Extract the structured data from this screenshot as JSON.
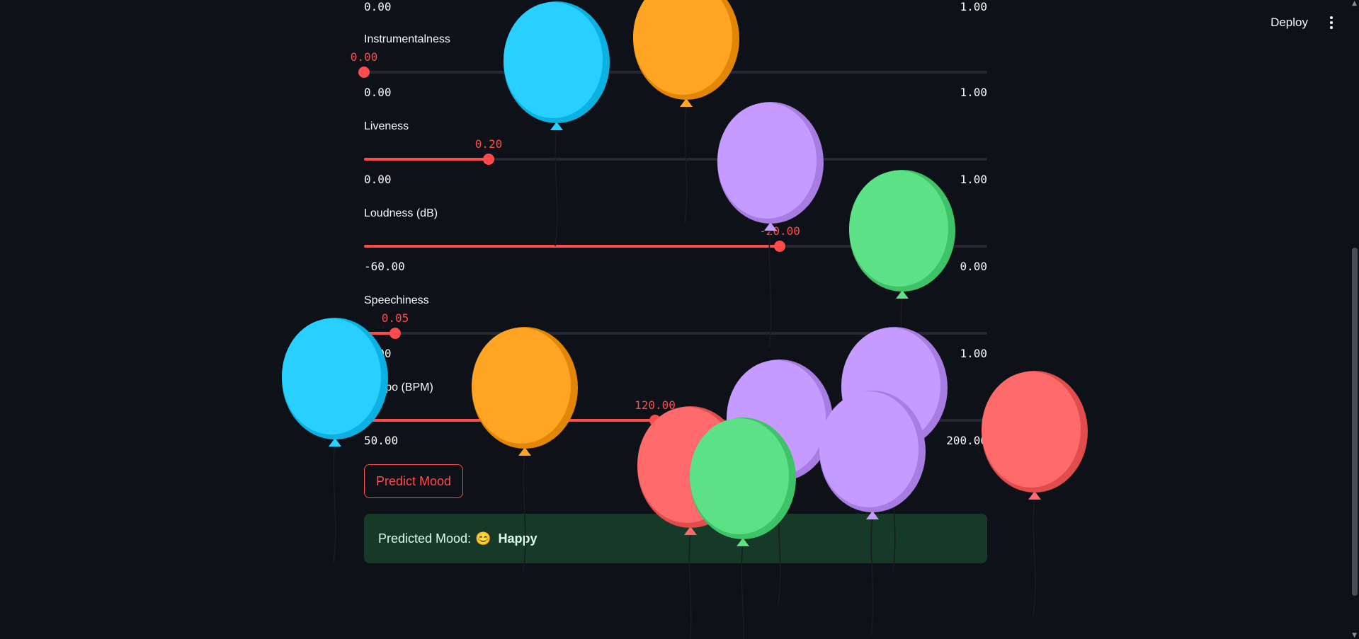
{
  "header": {
    "deploy_label": "Deploy",
    "menu_icon": "kebab-menu-icon"
  },
  "sliders": [
    {
      "label": "",
      "value": "",
      "min": "0.00",
      "max": "1.00",
      "fraction": null
    },
    {
      "label": "Instrumentalness",
      "value": "0.00",
      "min": "0.00",
      "max": "1.00",
      "fraction": 0.0
    },
    {
      "label": "Liveness",
      "value": "0.20",
      "min": "0.00",
      "max": "1.00",
      "fraction": 0.2
    },
    {
      "label": "Loudness (dB)",
      "value": "-20.00",
      "min": "-60.00",
      "max": "0.00",
      "fraction": 0.667
    },
    {
      "label": "Speechiness",
      "value": "0.05",
      "min": "0.00",
      "max": "1.00",
      "fraction": 0.05
    },
    {
      "label": "Tempo (BPM)",
      "value": "120.00",
      "min": "50.00",
      "max": "200.00",
      "fraction": 0.467
    }
  ],
  "predict_button": {
    "label": "Predict Mood"
  },
  "result": {
    "prefix": "Predicted Mood:",
    "emoji": "😊",
    "mood": "Happy"
  },
  "colors": {
    "background": "#0e1117",
    "accent": "#ff4b4b",
    "track": "#262730",
    "success_bg": "#173928",
    "balloon_blue": "#29d0ff",
    "balloon_orange": "#ffa423",
    "balloon_purple": "#c69bff",
    "balloon_green": "#5ce187",
    "balloon_red": "#ff6a6a"
  },
  "balloons": [
    {
      "color": "balloon_blue"
    },
    {
      "color": "balloon_orange"
    },
    {
      "color": "balloon_purple"
    },
    {
      "color": "balloon_green"
    },
    {
      "color": "balloon_blue"
    },
    {
      "color": "balloon_orange"
    },
    {
      "color": "balloon_purple"
    },
    {
      "color": "balloon_purple"
    },
    {
      "color": "balloon_red"
    },
    {
      "color": "balloon_green"
    },
    {
      "color": "balloon_purple"
    },
    {
      "color": "balloon_red"
    }
  ]
}
